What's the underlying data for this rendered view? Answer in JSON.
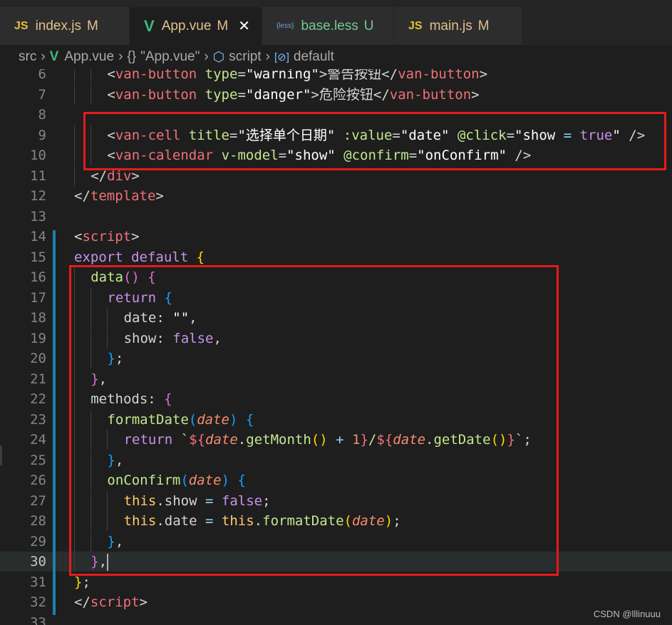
{
  "tabs": [
    {
      "icon": "JS",
      "name": "index.js",
      "flag": "M",
      "type": "js"
    },
    {
      "icon": "V",
      "name": "App.vue",
      "flag": "M",
      "type": "vue",
      "active": true
    },
    {
      "icon": "{less}",
      "name": "base.less",
      "flag": "U",
      "type": "less"
    },
    {
      "icon": "JS",
      "name": "main.js",
      "flag": "M",
      "type": "js"
    }
  ],
  "close_glyph": "✕",
  "breadcrumb": {
    "folder": "src",
    "file": "App.vue",
    "braces": "{}",
    "component": "\"App.vue\"",
    "block": "script",
    "symbol": "default"
  },
  "code": {
    "current_line": 30,
    "lines": [
      {
        "n": 6,
        "indent": 2,
        "tokens": [
          [
            "<",
            "br"
          ],
          [
            "van-button",
            "tag"
          ],
          [
            " type",
            "attr"
          ],
          [
            "=",
            "text"
          ],
          [
            "\"warning\"",
            "str"
          ],
          [
            ">",
            "br"
          ],
          [
            "警告按钮",
            "text"
          ],
          [
            "</",
            "br"
          ],
          [
            "van-button",
            "tag"
          ],
          [
            ">",
            "br"
          ]
        ]
      },
      {
        "n": 7,
        "indent": 2,
        "tokens": [
          [
            "<",
            "br"
          ],
          [
            "van-button",
            "tag"
          ],
          [
            " type",
            "attr"
          ],
          [
            "=",
            "text"
          ],
          [
            "\"danger\"",
            "str"
          ],
          [
            ">",
            "br"
          ],
          [
            "危险按钮",
            "text"
          ],
          [
            "</",
            "br"
          ],
          [
            "van-button",
            "tag"
          ],
          [
            ">",
            "br"
          ]
        ]
      },
      {
        "n": 8,
        "indent": 0,
        "tokens": []
      },
      {
        "n": 9,
        "indent": 2,
        "tokens": [
          [
            "<",
            "br"
          ],
          [
            "van-cell",
            "tag"
          ],
          [
            " title",
            "attr"
          ],
          [
            "=",
            "text"
          ],
          [
            "\"选择单个日期\"",
            "str"
          ],
          [
            " :value",
            "attr"
          ],
          [
            "=",
            "text"
          ],
          [
            "\"date\"",
            "str"
          ],
          [
            " @click",
            "attr"
          ],
          [
            "=",
            "text"
          ],
          [
            "\"show ",
            "str"
          ],
          [
            "=",
            "op"
          ],
          [
            " ",
            "str"
          ],
          [
            "true",
            "kw"
          ],
          [
            "\"",
            "str"
          ],
          [
            " />",
            "br"
          ]
        ]
      },
      {
        "n": 10,
        "indent": 2,
        "tokens": [
          [
            "<",
            "br"
          ],
          [
            "van-calendar",
            "tag"
          ],
          [
            " v-model",
            "attr"
          ],
          [
            "=",
            "text"
          ],
          [
            "\"show\"",
            "str"
          ],
          [
            " @confirm",
            "attr"
          ],
          [
            "=",
            "text"
          ],
          [
            "\"onConfirm\"",
            "str"
          ],
          [
            " />",
            "br"
          ]
        ]
      },
      {
        "n": 11,
        "indent": 1,
        "tokens": [
          [
            "</",
            "br"
          ],
          [
            "div",
            "tag"
          ],
          [
            ">",
            "br"
          ]
        ]
      },
      {
        "n": 12,
        "indent": 0,
        "tokens": [
          [
            "</",
            "br"
          ],
          [
            "template",
            "tag"
          ],
          [
            ">",
            "br"
          ]
        ]
      },
      {
        "n": 13,
        "indent": 0,
        "tokens": []
      },
      {
        "n": 14,
        "indent": 0,
        "tokens": [
          [
            "<",
            "br"
          ],
          [
            "script",
            "tag"
          ],
          [
            ">",
            "br"
          ]
        ]
      },
      {
        "n": 15,
        "indent": 0,
        "tokens": [
          [
            "export",
            "kw"
          ],
          [
            " ",
            "text"
          ],
          [
            "default",
            "kw"
          ],
          [
            " ",
            "text"
          ],
          [
            "{",
            "yellow"
          ]
        ]
      },
      {
        "n": 16,
        "indent": 1,
        "tokens": [
          [
            "data",
            "fn"
          ],
          [
            "()",
            "pink"
          ],
          [
            " ",
            "text"
          ],
          [
            "{",
            "pink"
          ]
        ]
      },
      {
        "n": 17,
        "indent": 2,
        "tokens": [
          [
            "return",
            "kw"
          ],
          [
            " ",
            "text"
          ],
          [
            "{",
            "blue"
          ]
        ]
      },
      {
        "n": 18,
        "indent": 3,
        "tokens": [
          [
            "date",
            "text"
          ],
          [
            ": ",
            "text"
          ],
          [
            "\"\"",
            "str"
          ],
          [
            ",",
            "text"
          ]
        ]
      },
      {
        "n": 19,
        "indent": 3,
        "tokens": [
          [
            "show",
            "text"
          ],
          [
            ": ",
            "text"
          ],
          [
            "false",
            "kw"
          ],
          [
            ",",
            "text"
          ]
        ]
      },
      {
        "n": 20,
        "indent": 2,
        "tokens": [
          [
            "}",
            "blue"
          ],
          [
            ";",
            "text"
          ]
        ]
      },
      {
        "n": 21,
        "indent": 1,
        "tokens": [
          [
            "}",
            "pink"
          ],
          [
            ",",
            "text"
          ]
        ]
      },
      {
        "n": 22,
        "indent": 1,
        "tokens": [
          [
            "methods",
            "text"
          ],
          [
            ": ",
            "text"
          ],
          [
            "{",
            "pink"
          ]
        ]
      },
      {
        "n": 23,
        "indent": 2,
        "tokens": [
          [
            "formatDate",
            "fn"
          ],
          [
            "(",
            "blue"
          ],
          [
            "date",
            "param"
          ],
          [
            ")",
            "blue"
          ],
          [
            " ",
            "text"
          ],
          [
            "{",
            "blue"
          ]
        ]
      },
      {
        "n": 24,
        "indent": 3,
        "tokens": [
          [
            "return",
            "kw"
          ],
          [
            " ",
            "text"
          ],
          [
            "`",
            "tpl"
          ],
          [
            "${",
            "dollar"
          ],
          [
            "date",
            "param"
          ],
          [
            ".",
            "text"
          ],
          [
            "getMonth",
            "fn"
          ],
          [
            "()",
            "yellow"
          ],
          [
            " ",
            "text"
          ],
          [
            "+",
            "op"
          ],
          [
            " ",
            "text"
          ],
          [
            "1",
            "num"
          ],
          [
            "}",
            "dollar"
          ],
          [
            "/",
            "tpl"
          ],
          [
            "${",
            "dollar"
          ],
          [
            "date",
            "param"
          ],
          [
            ".",
            "text"
          ],
          [
            "getDate",
            "fn"
          ],
          [
            "()",
            "yellow"
          ],
          [
            "}",
            "dollar"
          ],
          [
            "`",
            "tpl"
          ],
          [
            ";",
            "text"
          ]
        ]
      },
      {
        "n": 25,
        "indent": 2,
        "tokens": [
          [
            "}",
            "blue"
          ],
          [
            ",",
            "text"
          ]
        ]
      },
      {
        "n": 26,
        "indent": 2,
        "tokens": [
          [
            "onConfirm",
            "fn"
          ],
          [
            "(",
            "blue"
          ],
          [
            "date",
            "param"
          ],
          [
            ")",
            "blue"
          ],
          [
            " ",
            "text"
          ],
          [
            "{",
            "blue"
          ]
        ]
      },
      {
        "n": 27,
        "indent": 3,
        "tokens": [
          [
            "this",
            "this"
          ],
          [
            ".show ",
            "text"
          ],
          [
            "=",
            "op"
          ],
          [
            " ",
            "text"
          ],
          [
            "false",
            "kw"
          ],
          [
            ";",
            "text"
          ]
        ]
      },
      {
        "n": 28,
        "indent": 3,
        "tokens": [
          [
            "this",
            "this"
          ],
          [
            ".date ",
            "text"
          ],
          [
            "=",
            "op"
          ],
          [
            " ",
            "text"
          ],
          [
            "this",
            "this"
          ],
          [
            ".",
            "text"
          ],
          [
            "formatDate",
            "fn"
          ],
          [
            "(",
            "yellow"
          ],
          [
            "date",
            "param"
          ],
          [
            ")",
            "yellow"
          ],
          [
            ";",
            "text"
          ]
        ]
      },
      {
        "n": 29,
        "indent": 2,
        "tokens": [
          [
            "}",
            "blue"
          ],
          [
            ",",
            "text"
          ]
        ]
      },
      {
        "n": 30,
        "indent": 1,
        "tokens": [
          [
            "}",
            "pink"
          ],
          [
            ",",
            "text"
          ]
        ]
      },
      {
        "n": 31,
        "indent": 0,
        "tokens": [
          [
            "}",
            "yellow"
          ],
          [
            ";",
            "text"
          ]
        ]
      },
      {
        "n": 32,
        "indent": 0,
        "tokens": [
          [
            "</",
            "br"
          ],
          [
            "script",
            "tag"
          ],
          [
            ">",
            "br"
          ]
        ]
      },
      {
        "n": 33,
        "indent": 0,
        "tokens": []
      }
    ]
  },
  "watermark": "CSDN @lllinuuu",
  "colors": {
    "highlight_box": "#e51b1b",
    "editor_bg": "#1e1e1e",
    "tab_bg": "#2d2d2d"
  }
}
